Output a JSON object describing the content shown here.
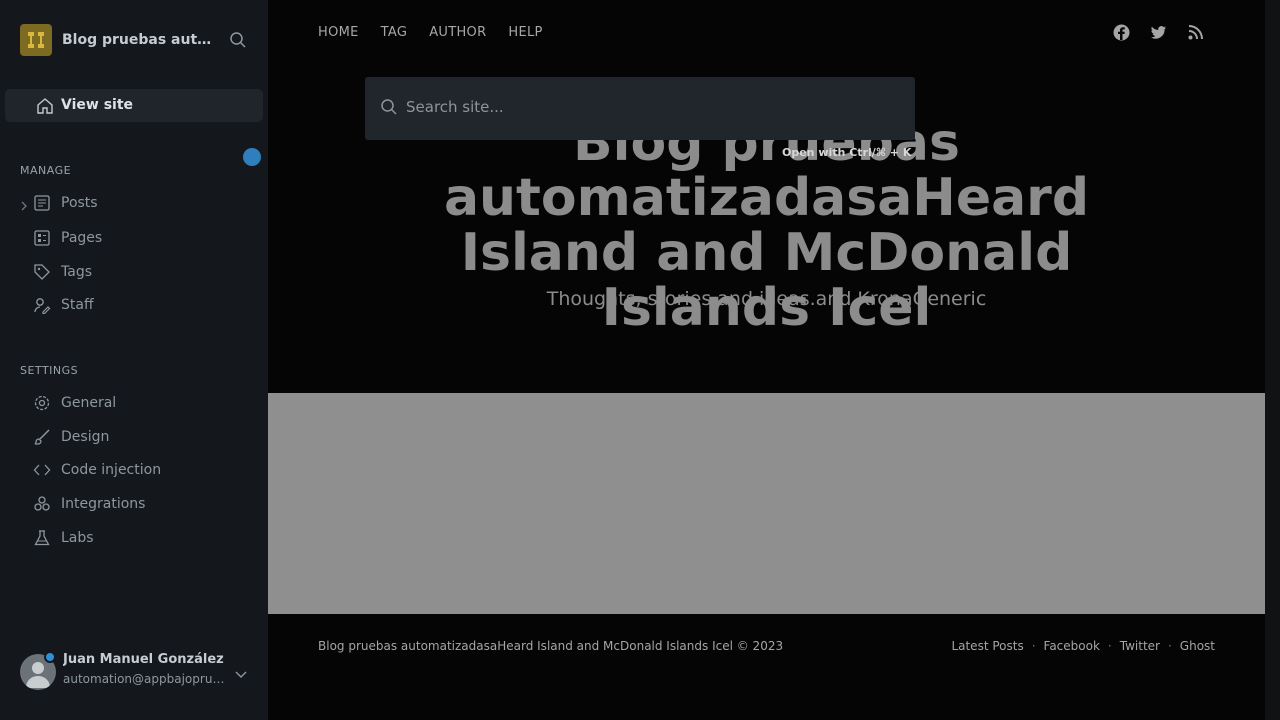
{
  "sidebar": {
    "site_title": "Blog pruebas automatizadasaHeard Island and McDonald Islands Icel",
    "view_site": "View site",
    "manage_label": "MANAGE",
    "manage_items": [
      {
        "label": "Posts",
        "icon": "posts-icon"
      },
      {
        "label": "Pages",
        "icon": "pages-icon"
      },
      {
        "label": "Tags",
        "icon": "tag-icon"
      },
      {
        "label": "Staff",
        "icon": "staff-icon"
      }
    ],
    "settings_label": "SETTINGS",
    "settings_items": [
      {
        "label": "General",
        "icon": "gear-icon"
      },
      {
        "label": "Design",
        "icon": "brush-icon"
      },
      {
        "label": "Code injection",
        "icon": "code-icon"
      },
      {
        "label": "Integrations",
        "icon": "integrations-icon"
      },
      {
        "label": "Labs",
        "icon": "flask-icon"
      }
    ],
    "user": {
      "name": "Juan Manuel González",
      "email": "automation@appbajopruebas.com"
    }
  },
  "site": {
    "nav": [
      "HOME",
      "TAG",
      "AUTHOR",
      "HELP"
    ],
    "socials": [
      "facebook-icon",
      "twitter-icon",
      "rss-icon"
    ],
    "title": "Blog pruebas automatizadasaHeard Island and McDonald Islands Icel",
    "description": "Thoughts, stories and ideas.and KronaGeneric",
    "search_placeholder": "Search site...",
    "search_hint": "Open with Ctrl/⌘ + K",
    "footer_copy": "Blog pruebas automatizadasaHeard Island and McDonald Islands Icel © 2023",
    "footer_links": [
      "Latest Posts",
      "Facebook",
      "Twitter",
      "Ghost"
    ]
  },
  "colors": {
    "sidebar_bg": "#14181c",
    "brand_accent": "#7d6a23",
    "notification_dot": "#2f7fbd"
  }
}
